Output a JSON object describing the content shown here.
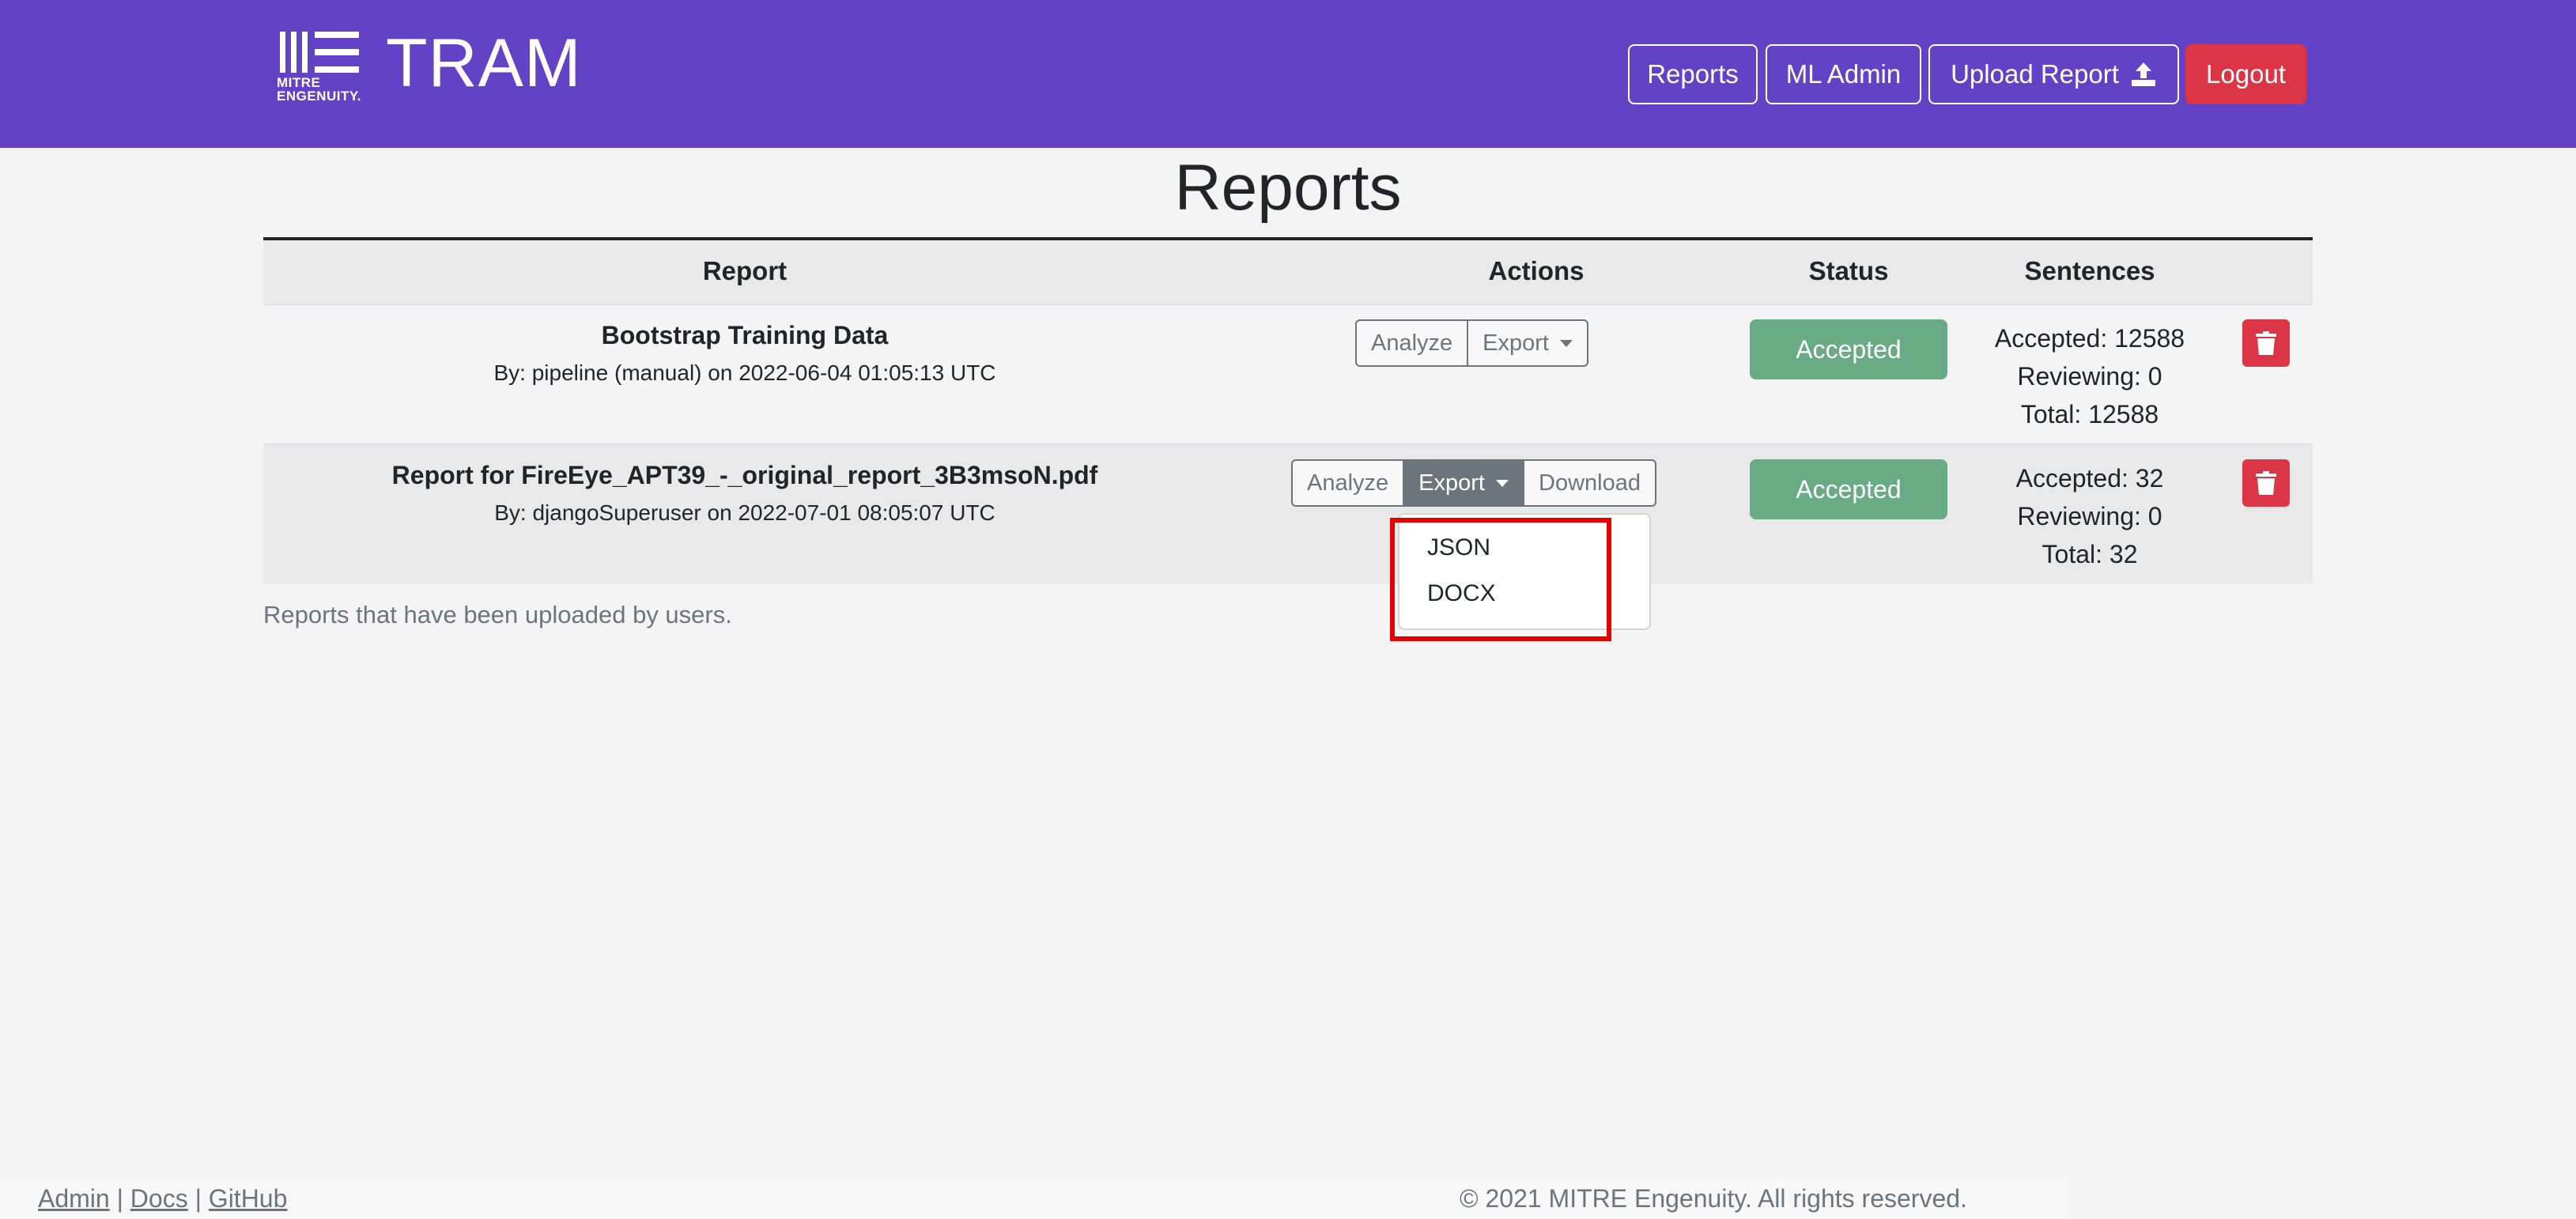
{
  "header": {
    "logo_text_line1": "MITRE",
    "logo_text_line2": "ENGENUITY.",
    "brand": "TRAM",
    "nav": {
      "reports": "Reports",
      "ml_admin": "ML Admin",
      "upload_report": "Upload Report",
      "logout": "Logout"
    }
  },
  "page": {
    "title": "Reports",
    "caption": "Reports that have been uploaded by users."
  },
  "table": {
    "headers": {
      "report": "Report",
      "actions": "Actions",
      "status": "Status",
      "sentences": "Sentences"
    },
    "rows": [
      {
        "title": "Bootstrap Training Data",
        "by": "By: pipeline (manual) on 2022-06-04 01:05:13 UTC",
        "actions": {
          "analyze": "Analyze",
          "export": "Export"
        },
        "status": "Accepted",
        "accepted": "Accepted: 12588",
        "reviewing": "Reviewing: 0",
        "total": "Total: 12588"
      },
      {
        "title": "Report for FireEye_APT39_-_original_report_3B3msoN.pdf",
        "by": "By: djangoSuperuser on 2022-07-01 08:05:07 UTC",
        "actions": {
          "analyze": "Analyze",
          "export": "Export",
          "download": "Download"
        },
        "status": "Accepted",
        "accepted": "Accepted: 32",
        "reviewing": "Reviewing: 0",
        "total": "Total: 32"
      }
    ]
  },
  "export_dropdown": {
    "items": [
      "JSON",
      "DOCX"
    ]
  },
  "footer": {
    "links": [
      "Admin",
      "Docs",
      "GitHub"
    ],
    "separator": "|",
    "copyright": "© 2021 MITRE Engenuity. All rights reserved."
  },
  "colors": {
    "navbar": "#6342c6",
    "danger": "#dc3545",
    "success_badge": "#68ab85",
    "highlight": "#e50000"
  },
  "icons": {
    "upload": "upload-icon",
    "trash": "trash-icon",
    "logo": "mitre-engenuity-logo-icon"
  }
}
